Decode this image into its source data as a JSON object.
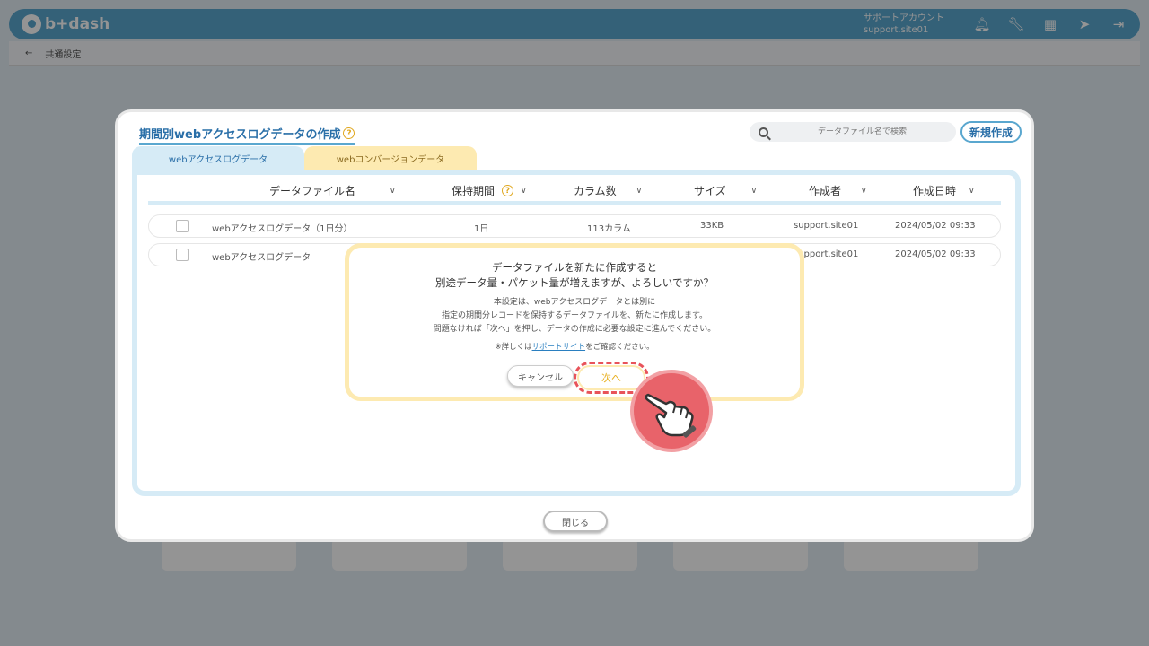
{
  "header": {
    "logo_text": "b+dash",
    "account_label": "サポートアカウント",
    "account_id": "support.site01",
    "icons": [
      "bell-icon",
      "wrench-icon",
      "grid-icon",
      "rocket-icon",
      "logout-icon"
    ]
  },
  "subheader": {
    "back": "←",
    "breadcrumb": "共通設定"
  },
  "modal": {
    "title": "期間別webアクセスログデータの作成",
    "search_placeholder": "データファイル名で検索",
    "new_button": "新規作成",
    "tabs": [
      {
        "label": "webアクセスログデータ",
        "active": true
      },
      {
        "label": "webコンバージョンデータ",
        "active": false
      }
    ],
    "columns": [
      "データファイル名",
      "保持期間",
      "カラム数",
      "サイズ",
      "作成者",
      "作成日時"
    ],
    "rows": [
      {
        "name": "webアクセスログデータ（1日分）",
        "period": "1日",
        "columns": "113カラム",
        "size": "33KB",
        "creator": "support.site01",
        "created": "2024/05/02 09:33"
      },
      {
        "name": "webアクセスログデータ",
        "period": "",
        "columns": "",
        "size": "",
        "creator": "support.site01",
        "created": "2024/05/02 09:33"
      }
    ],
    "close_button": "閉じる"
  },
  "confirm": {
    "title_line1": "データファイルを新たに作成すると",
    "title_line2": "別途データ量・パケット量が増えますが、よろしいですか？",
    "body_line1": "本設定は、webアクセスログデータとは別に",
    "body_line2": "指定の期間分レコードを保持するデータファイルを、新たに作成します。",
    "body_line3": "問題なければ「次へ」を押し、データの作成に必要な設定に進んでください。",
    "note_prefix": "※詳しくは",
    "note_link": "サポートサイト",
    "note_suffix": "をご確認ください。",
    "cancel_button": "キャンセル",
    "next_button": "次へ"
  },
  "colors": {
    "brand": "#5aa7cf",
    "accent_yellow": "#fdeab1",
    "highlight_red": "#e8535a"
  }
}
